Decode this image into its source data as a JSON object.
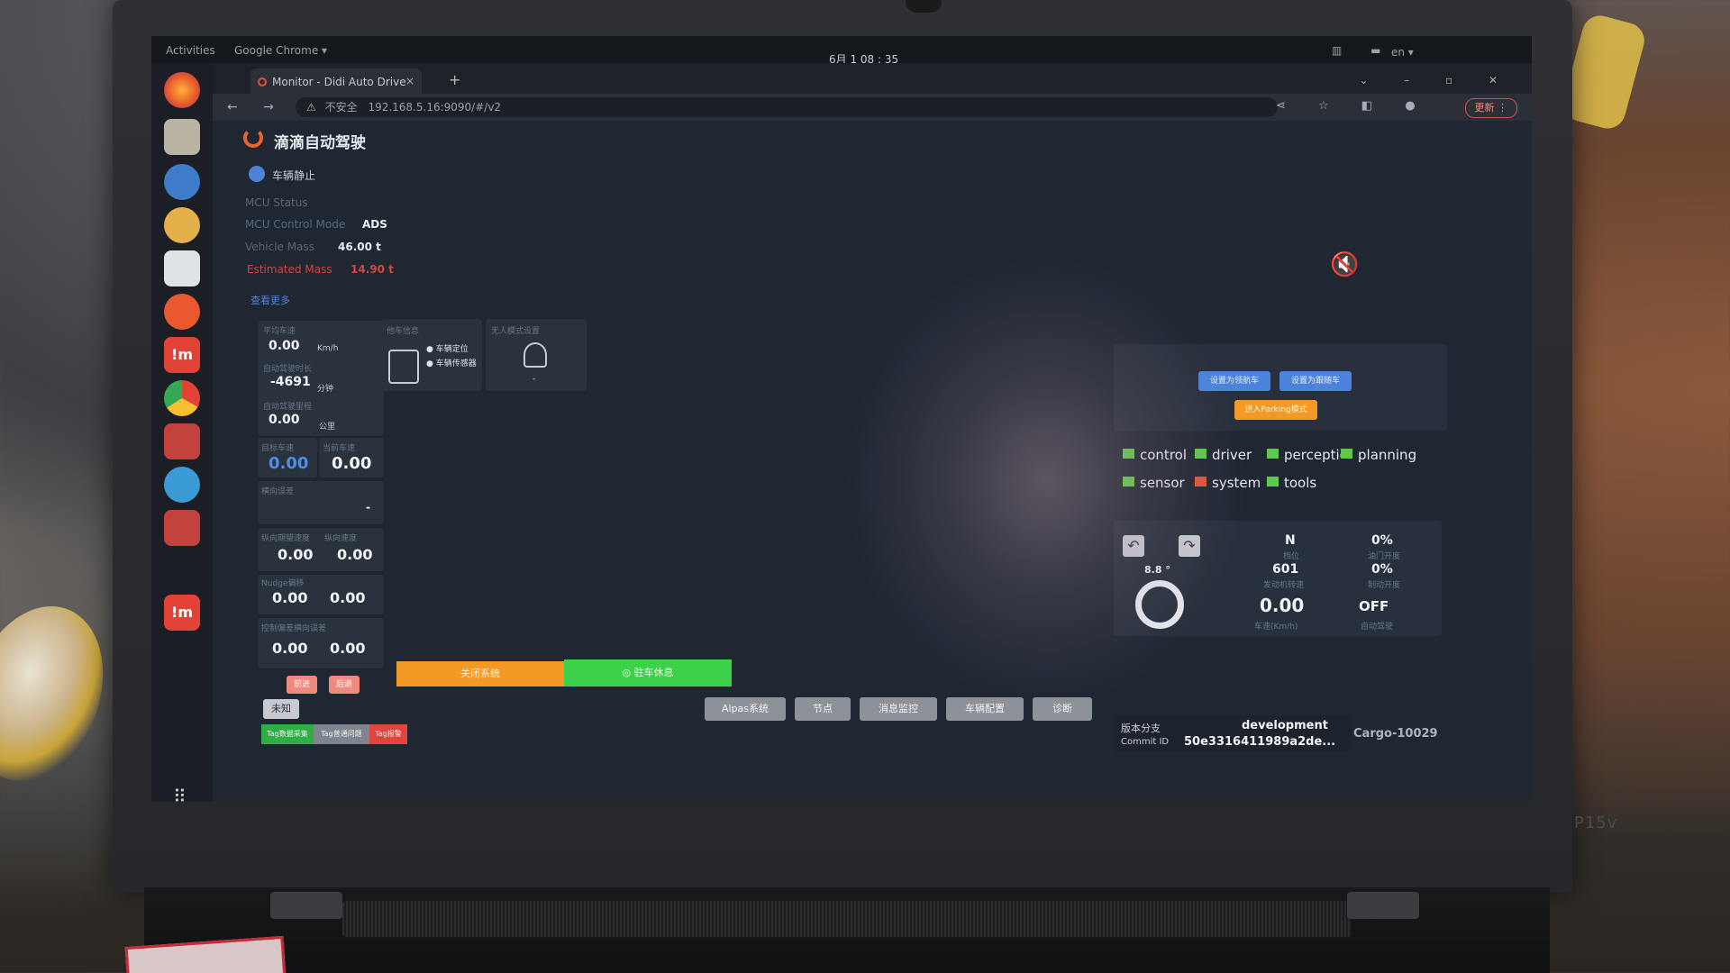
{
  "os": {
    "activities": "Activities",
    "app_menu": "Google Chrome ▾",
    "clock": "6月 1 08 : 35",
    "language": "en ▾"
  },
  "browser": {
    "tab_title": "Monitor - Didi Auto Drive",
    "tab_close": "×",
    "new_tab": "+",
    "security_label": "不安全",
    "url": "192.168.5.16:9090/#/v2",
    "update_label": "更新 ⋮"
  },
  "brand": {
    "title": "滴滴自动驾驶",
    "laptop_model": "P15v"
  },
  "vehicle": {
    "status_text": "车辆静止",
    "mcu_status_label": "MCU Status",
    "mcu_mode_label": "MCU Control Mode",
    "mcu_mode_value": "ADS",
    "mass_label": "Vehicle Mass",
    "mass_value": "46.00 t",
    "est_mass_label": "Estimated Mass",
    "est_mass_value": "14.90 t",
    "more_link": "查看更多"
  },
  "stats": {
    "speed_label": "平均车速",
    "speed_value": "0.00",
    "speed_unit": "Km/h",
    "time_label": "自动驾驶时长",
    "time_value": "-4691",
    "time_unit": "分钟",
    "dist_label": "自动驾驶里程",
    "dist_value": "0.00",
    "dist_unit": "公里"
  },
  "vehicle_info": {
    "title": "他车信息",
    "opt1": "车辆定位",
    "opt2": "车辆传感器"
  },
  "unmanned": {
    "title": "无人模式设置",
    "value": "-"
  },
  "speeds": {
    "target_label": "目标车速",
    "target_value": "0.00",
    "current_label": "当前车速",
    "current_value": "0.00",
    "lateral_label": "横向误差",
    "lateral_value": "-",
    "long_label1": "纵向期望速度",
    "long_value1": "0.00",
    "long_label2": "纵向速度",
    "long_value2": "0.00",
    "nudge_label": "Nudge偏移",
    "nudge_value1": "0.00",
    "nudge_value2": "0.00",
    "ctrl_label": "控制偏差横向误差",
    "ctrl_value1": "0.00",
    "ctrl_value2": "0.00"
  },
  "buttons": {
    "small_left": "前进",
    "small_right": "后退",
    "unknown": "未知",
    "close_system": "关闭系统",
    "park_rest": "◎ 驻车休息",
    "tag_collect": "Tag数据采集",
    "tag_issue": "Tag普通问题",
    "tag_alarm": "Tag报警",
    "alpas": "Alpas系统",
    "nodes": "节点",
    "msg_monitor": "消息监控",
    "vehicle_config": "车辆配置",
    "diagnose": "诊断",
    "set_lead": "设置为领航车",
    "set_follow": "设置为跟随车",
    "enter_parking": "进入Parking模式"
  },
  "modules": [
    {
      "name": "control",
      "status": "ok"
    },
    {
      "name": "driver",
      "status": "ok"
    },
    {
      "name": "perception",
      "status": "ok"
    },
    {
      "name": "planning",
      "status": "ok"
    },
    {
      "name": "sensor",
      "status": "ok"
    },
    {
      "name": "system",
      "status": "error"
    },
    {
      "name": "tools",
      "status": "ok"
    }
  ],
  "drive": {
    "steer_angle": "8.8 °",
    "gear": "N",
    "gear_label": "档位",
    "throttle": "0%",
    "throttle_label": "油门开度",
    "rpm": "601",
    "rpm_label": "发动机转速",
    "brake": "0%",
    "brake_label": "制动开度",
    "speed": "0.00",
    "speed_label": "车速(Km/h)",
    "auto": "OFF",
    "auto_label": "自动驾驶"
  },
  "version": {
    "branch_label": "版本分支",
    "branch_value": "development",
    "commit_label": "Commit ID",
    "commit_value": "50e3316411989a2de...",
    "vehicle_id": "Cargo-10029"
  },
  "colors": {
    "ok": "#5fc94e",
    "error": "#e1553f",
    "accent_orange": "#f29a25",
    "accent_green": "#3dd14a",
    "accent_blue": "#4b83dc"
  }
}
